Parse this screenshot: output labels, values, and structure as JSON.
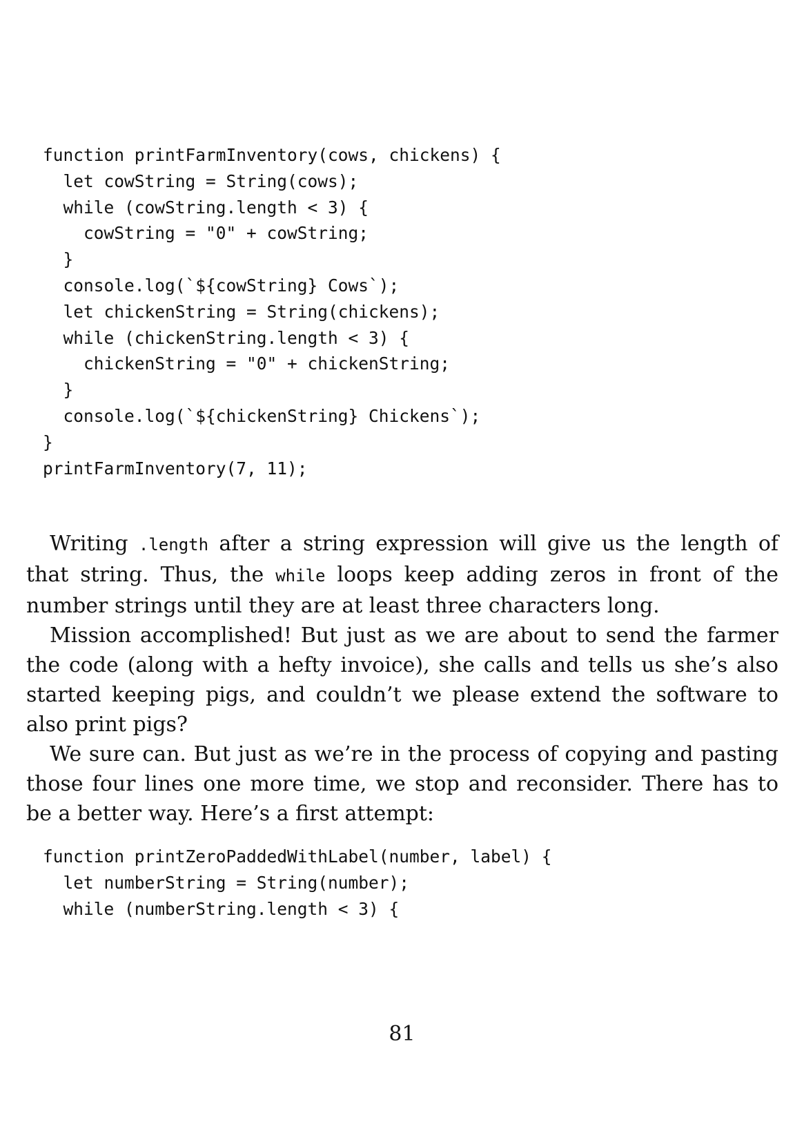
{
  "code_block_1": {
    "lines": [
      "function printFarmInventory(cows, chickens) {",
      "  let cowString = String(cows);",
      "  while (cowString.length < 3) {",
      "    cowString = \"0\" + cowString;",
      "  }",
      "  console.log(`${cowString} Cows`);",
      "  let chickenString = String(chickens);",
      "  while (chickenString.length < 3) {",
      "    chickenString = \"0\" + chickenString;",
      "  }",
      "  console.log(`${chickenString} Chickens`);",
      "}",
      "printFarmInventory(7, 11);"
    ]
  },
  "paragraphs": {
    "p1": {
      "part1": "Writing ",
      "code1": ".length",
      "part2": " after a string expression will give us the length of that string. Thus, the ",
      "code2": "while",
      "part3": " loops keep adding zeros in front of the number strings until they are at least three characters long."
    },
    "p2": "Mission accomplished! But just as we are about to send the farmer the code (along with a hefty invoice), she calls and tells us she’s also started keeping pigs, and couldn’t we please extend the software to also print pigs?",
    "p3": "We sure can. But just as we’re in the process of copying and pasting those four lines one more time, we stop and reconsider. There has to be a better way. Here’s a first attempt:"
  },
  "code_block_2": {
    "lines": [
      "function printZeroPaddedWithLabel(number, label) {",
      "  let numberString = String(number);",
      "  while (numberString.length < 3) {"
    ]
  },
  "page_number": "81"
}
